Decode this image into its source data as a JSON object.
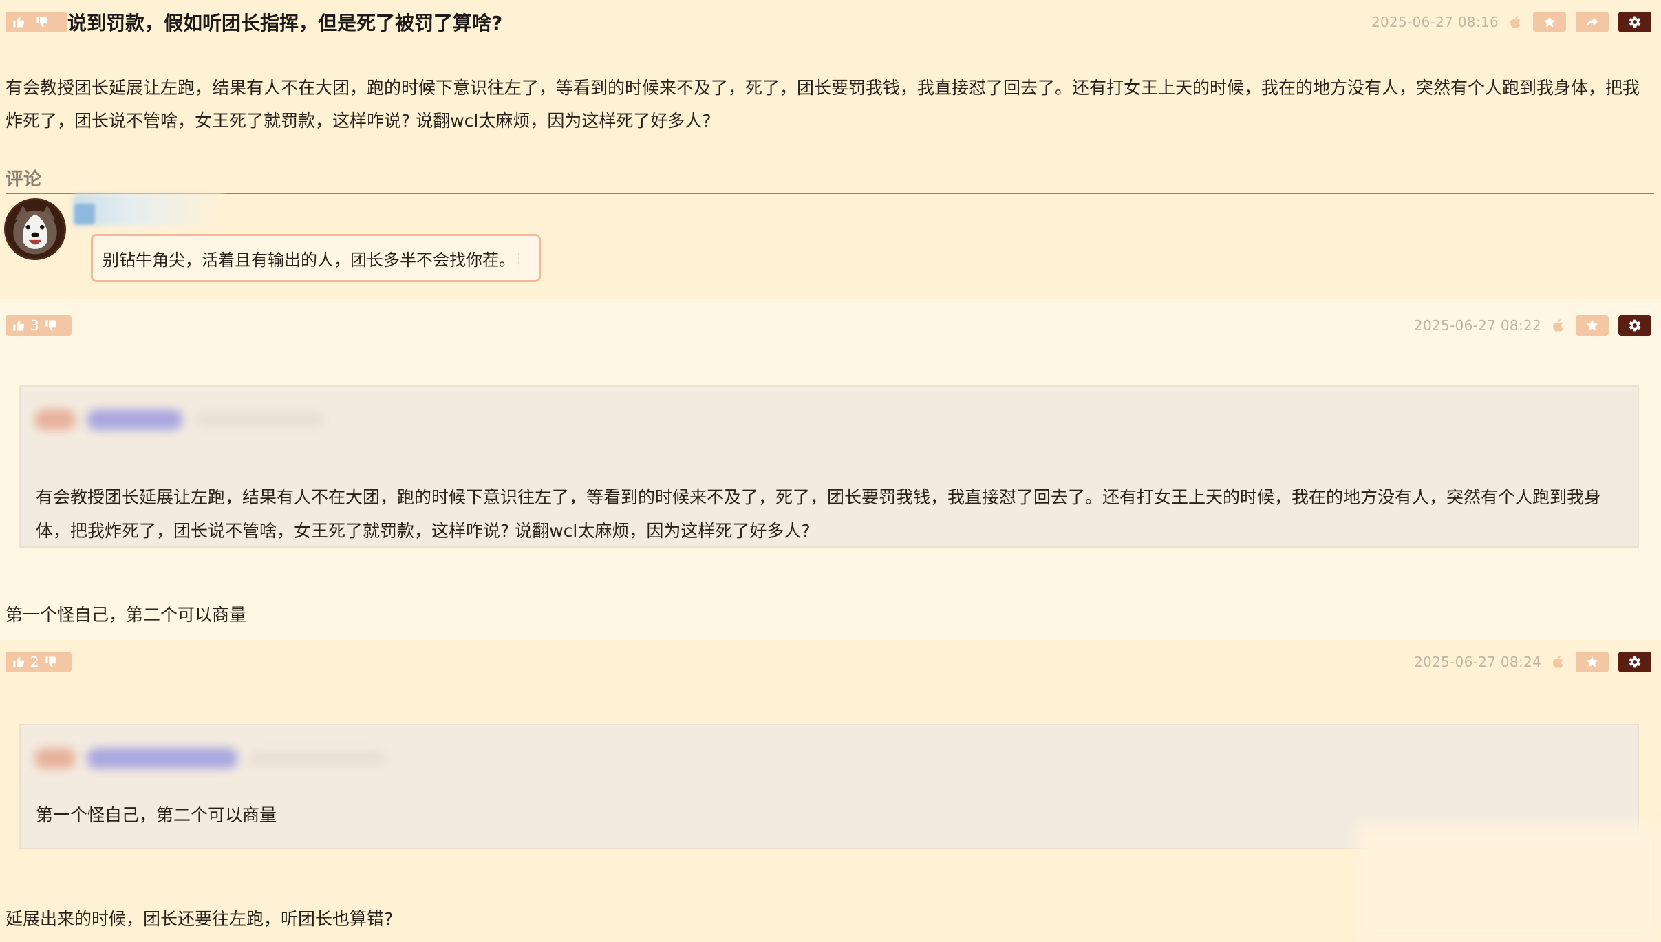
{
  "posts": [
    {
      "votes": {
        "count": ""
      },
      "timestamp": "2025-06-27 08:16",
      "title": "说到罚款，假如听团长指挥，但是死了被罚了算啥?",
      "body": "有会教授团长延展让左跑，结果有人不在大团，跑的时候下意识往左了，等看到的时候来不及了，死了，团长要罚我钱，我直接怼了回去了。还有打女王上天的时候，我在的地方没有人，突然有个人跑到我身体，把我炸死了，团长说不管啥，女王死了就罚款，这样咋说? 说翻wcl太麻烦，因为这样死了好多人?",
      "comments_label": "评论",
      "comment": {
        "text": "别钻牛角尖，活着且有输出的人，团长多半不会找你茬。",
        "more": "⋮"
      }
    },
    {
      "votes": {
        "count": "3"
      },
      "timestamp": "2025-06-27 08:22",
      "quote": "有会教授团长延展让左跑，结果有人不在大团，跑的时候下意识往左了，等看到的时候来不及了，死了，团长要罚我钱，我直接怼了回去了。还有打女王上天的时候，我在的地方没有人，突然有个人跑到我身体，把我炸死了，团长说不管啥，女王死了就罚款，这样咋说? 说翻wcl太麻烦，因为这样死了好多人?",
      "reply": "第一个怪自己，第二个可以商量"
    },
    {
      "votes": {
        "count": "2"
      },
      "timestamp": "2025-06-27 08:24",
      "quote": "第一个怪自己，第二个可以商量",
      "reply": "延展出来的时候，团长还要往左跑，听团长也算错?"
    }
  ],
  "icons": {
    "thumb_up": "thumbs-up-icon",
    "thumb_down": "thumbs-down-icon",
    "platform": "apple-icon",
    "favorite": "star-icon",
    "share": "share-icon",
    "settings": "gear-icon"
  },
  "colors": {
    "background": "#fff1d4",
    "alt_background": "#fff7e3",
    "vote_badge": "#f3c7a4",
    "settings_button": "#5a1e12",
    "quote_background": "#f4ebe0",
    "comment_border": "#f2b89a"
  }
}
